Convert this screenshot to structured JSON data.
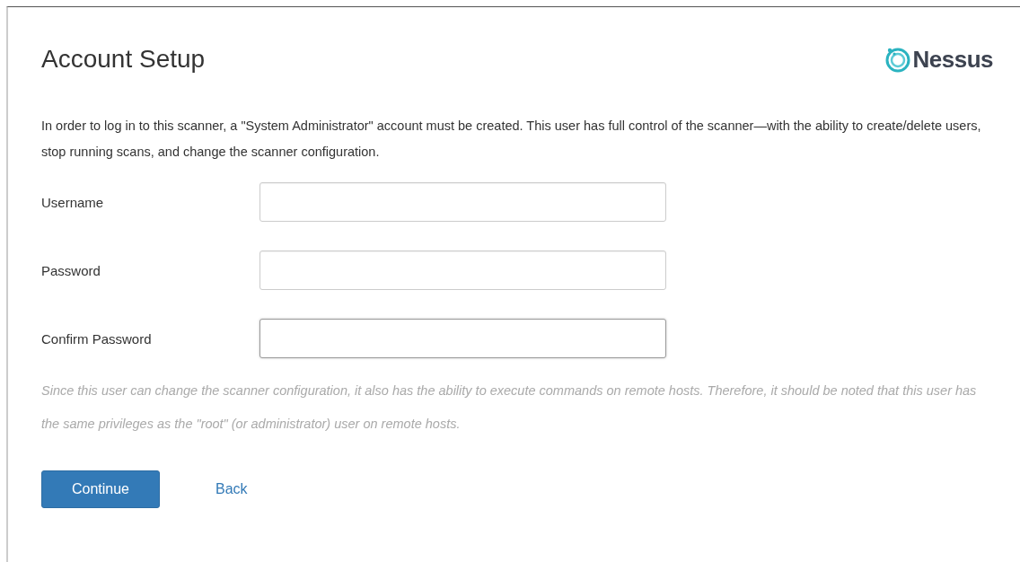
{
  "title": "Account Setup",
  "logo": {
    "text": "Nessus"
  },
  "description": "In order to log in to this scanner, a \"System Administrator\" account must be created. This user has full control of the scanner—with the ability to create/delete users, stop running scans, and change the scanner configuration.",
  "fields": [
    {
      "label": "Username",
      "focused": false
    },
    {
      "label": "Password",
      "focused": false
    },
    {
      "label": "Confirm Password",
      "focused": true
    }
  ],
  "note": "Since this user can change the scanner configuration, it also has the ability to execute commands on remote hosts. Therefore, it should be noted that this user has the same privileges as the \"root\" (or administrator) user on remote hosts.",
  "buttons": [
    {
      "label": "Continue",
      "kind": "primary"
    },
    {
      "label": "Back",
      "kind": "link"
    }
  ]
}
